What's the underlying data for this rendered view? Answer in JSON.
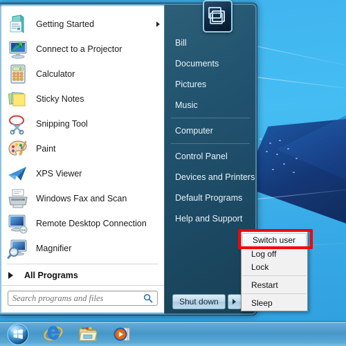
{
  "os": {
    "name": "Windows 7 Start Menu"
  },
  "start_menu": {
    "programs": [
      {
        "label": "Getting Started",
        "icon": "getting-started-icon",
        "has_submenu": true
      },
      {
        "label": "Connect to a Projector",
        "icon": "connect-to-projector-icon",
        "has_submenu": false
      },
      {
        "label": "Calculator",
        "icon": "calculator-icon",
        "has_submenu": false
      },
      {
        "label": "Sticky Notes",
        "icon": "sticky-notes-icon",
        "has_submenu": false
      },
      {
        "label": "Snipping Tool",
        "icon": "snipping-tool-icon",
        "has_submenu": false
      },
      {
        "label": "Paint",
        "icon": "paint-icon",
        "has_submenu": false
      },
      {
        "label": "XPS Viewer",
        "icon": "xps-viewer-icon",
        "has_submenu": false
      },
      {
        "label": "Windows Fax and Scan",
        "icon": "fax-and-scan-icon",
        "has_submenu": false
      },
      {
        "label": "Remote Desktop Connection",
        "icon": "remote-desktop-icon",
        "has_submenu": false
      },
      {
        "label": "Magnifier",
        "icon": "magnifier-icon",
        "has_submenu": false
      }
    ],
    "all_programs_label": "All Programs",
    "search": {
      "placeholder": "Search programs and files",
      "value": "",
      "icon": "search-icon"
    },
    "places": [
      {
        "label": "Bill",
        "separator_after": false
      },
      {
        "label": "Documents",
        "separator_after": false
      },
      {
        "label": "Pictures",
        "separator_after": false
      },
      {
        "label": "Music",
        "separator_after": true
      },
      {
        "label": "Computer",
        "separator_after": true
      },
      {
        "label": "Control Panel",
        "separator_after": false
      },
      {
        "label": "Devices and Printers",
        "separator_after": false
      },
      {
        "label": "Default Programs",
        "separator_after": false
      },
      {
        "label": "Help and Support",
        "separator_after": false
      }
    ],
    "shutdown": {
      "label": "Shut down",
      "arrow_icon": "chevron-right-icon"
    },
    "user_avatar": {
      "icon": "user-account-picture"
    }
  },
  "power_menu": {
    "items": [
      {
        "label": "Switch user",
        "selected": true,
        "separator_after": false
      },
      {
        "label": "Log off",
        "selected": false,
        "separator_after": false
      },
      {
        "label": "Lock",
        "selected": false,
        "separator_after": true
      },
      {
        "label": "Restart",
        "selected": false,
        "separator_after": true
      },
      {
        "label": "Sleep",
        "selected": false,
        "separator_after": false
      }
    ]
  },
  "annotation": {
    "highlight_color": "#f60000",
    "target": "Switch user"
  },
  "taskbar": {
    "start_orb": {
      "icon": "windows-start-orb"
    },
    "buttons": [
      {
        "icon": "internet-explorer-icon",
        "label": "Internet Explorer"
      },
      {
        "icon": "windows-explorer-icon",
        "label": "Windows Explorer"
      },
      {
        "icon": "media-player-icon",
        "label": "Windows Media Player"
      }
    ]
  },
  "colors": {
    "desktop_bg": "#45bdf3",
    "menu_border": "#0f3f63",
    "right_pane_bg": "#22546f",
    "taskbar_bg": "#4896c8"
  }
}
